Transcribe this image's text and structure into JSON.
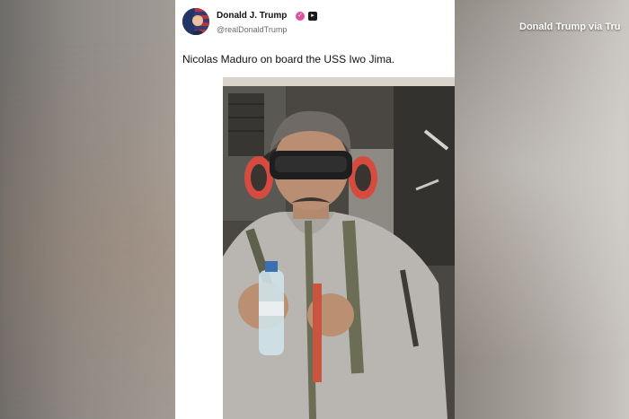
{
  "overlay": {
    "credit": "Donald Trump via Tru"
  },
  "post": {
    "author": {
      "name": "Donald J. Trump",
      "handle": "@realDonaldTrump",
      "avatar_icon": "flag-portrait-avatar",
      "badges": [
        "verified-badge-icon",
        "media-badge-icon"
      ]
    },
    "text": "Nicolas Maduro on board the USS Iwo Jima.",
    "image": {
      "subject": "photo",
      "icon": "photo"
    }
  },
  "colors": {
    "post_bg": "#ffffff",
    "badge_pink": "#e04fa0",
    "text_primary": "#111111",
    "text_secondary": "#6c6c6c"
  }
}
